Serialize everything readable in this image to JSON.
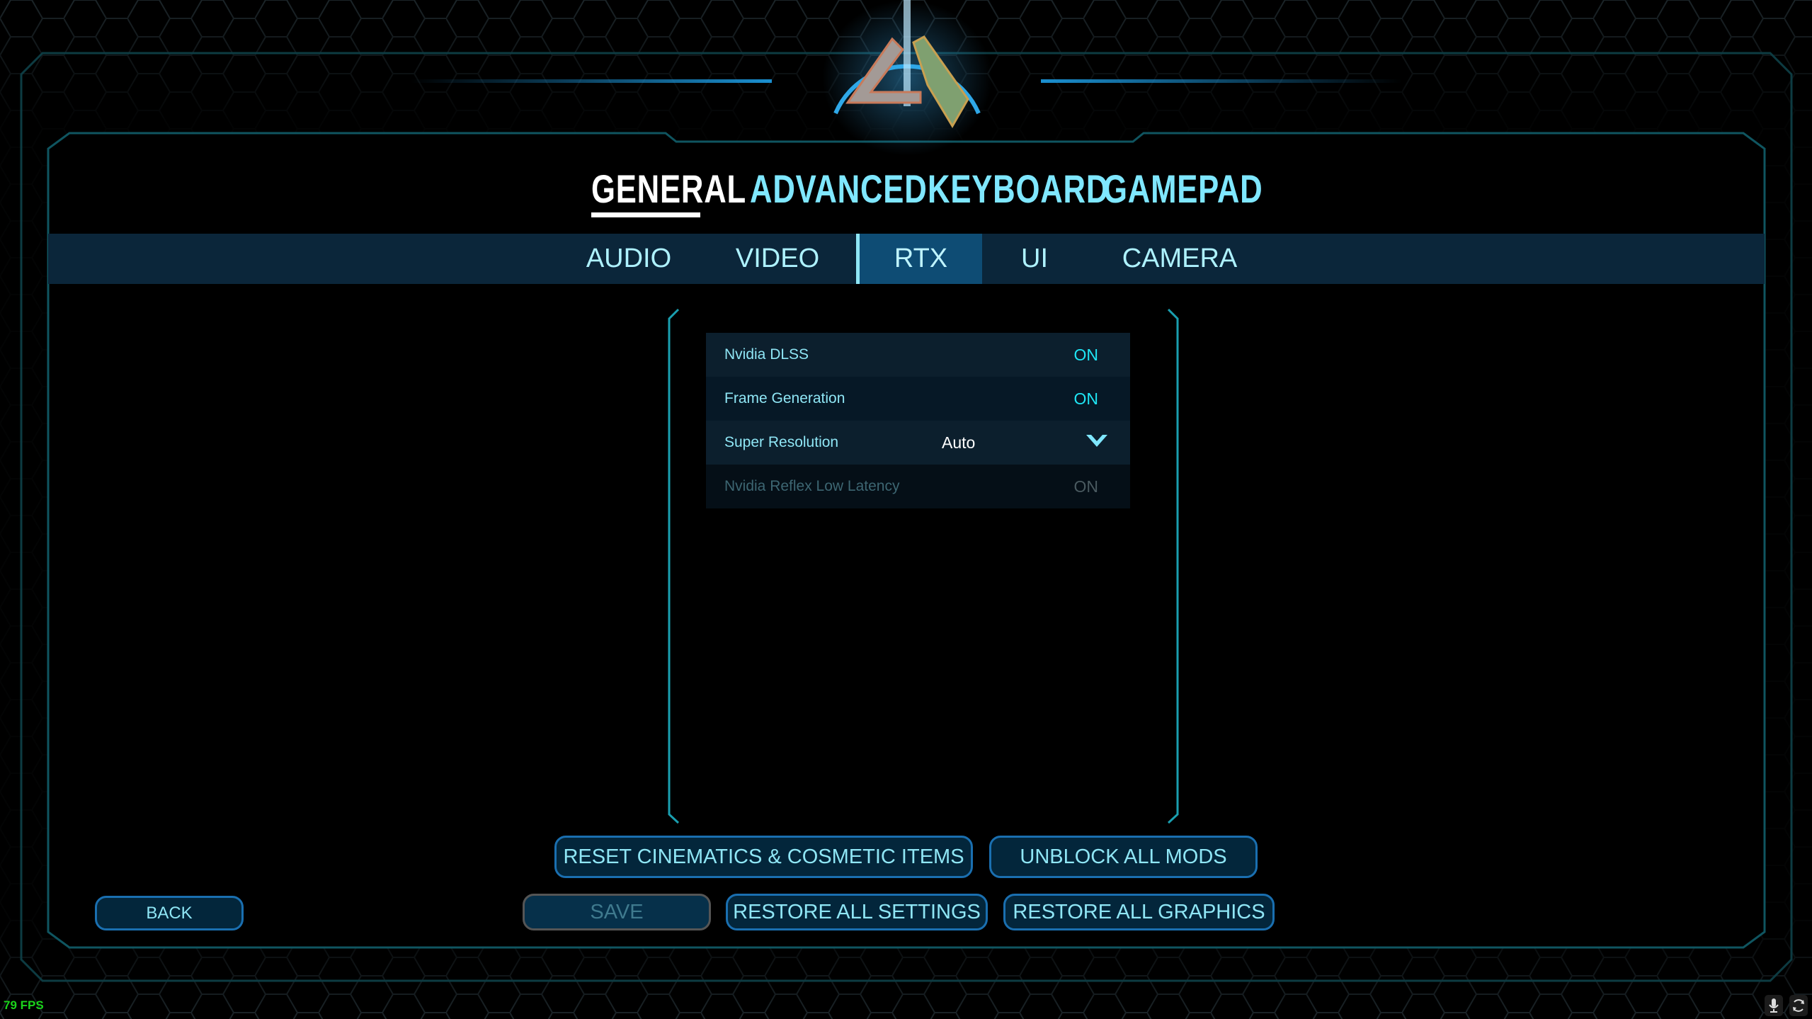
{
  "top_tabs": [
    {
      "label": "GENERAL",
      "active": true
    },
    {
      "label": "ADVANCED"
    },
    {
      "label": "KEYBOARD"
    },
    {
      "label": "GAMEPAD"
    }
  ],
  "sub_tabs": [
    {
      "label": "AUDIO"
    },
    {
      "label": "VIDEO"
    },
    {
      "label": "RTX",
      "active": true
    },
    {
      "label": "UI"
    },
    {
      "label": "CAMERA"
    }
  ],
  "settings": [
    {
      "label": "Nvidia DLSS",
      "value": "ON"
    },
    {
      "label": "Frame Generation",
      "value": "ON"
    },
    {
      "label": "Super Resolution",
      "value": "Auto"
    },
    {
      "label": "Nvidia Reflex Low Latency",
      "value": "ON",
      "disabled": true
    }
  ],
  "buttons": {
    "reset": "RESET CINEMATICS & COSMETIC ITEMS",
    "unblock": "UNBLOCK ALL MODS",
    "back": "BACK",
    "save": "SAVE",
    "restore_settings": "RESTORE ALL SETTINGS",
    "restore_graphics": "RESTORE ALL GRAPHICS"
  },
  "fps": "79 FPS",
  "icons": {
    "logo": "ark-logo",
    "mic": "microphone-icon",
    "sync": "sync-icon",
    "dropdown": "chevron-down-icon"
  },
  "colors": {
    "accent": "#7fe7ff",
    "active_subtab": "#0e4c74",
    "subbar": "#0b263a",
    "fps": "#1bd41b"
  }
}
